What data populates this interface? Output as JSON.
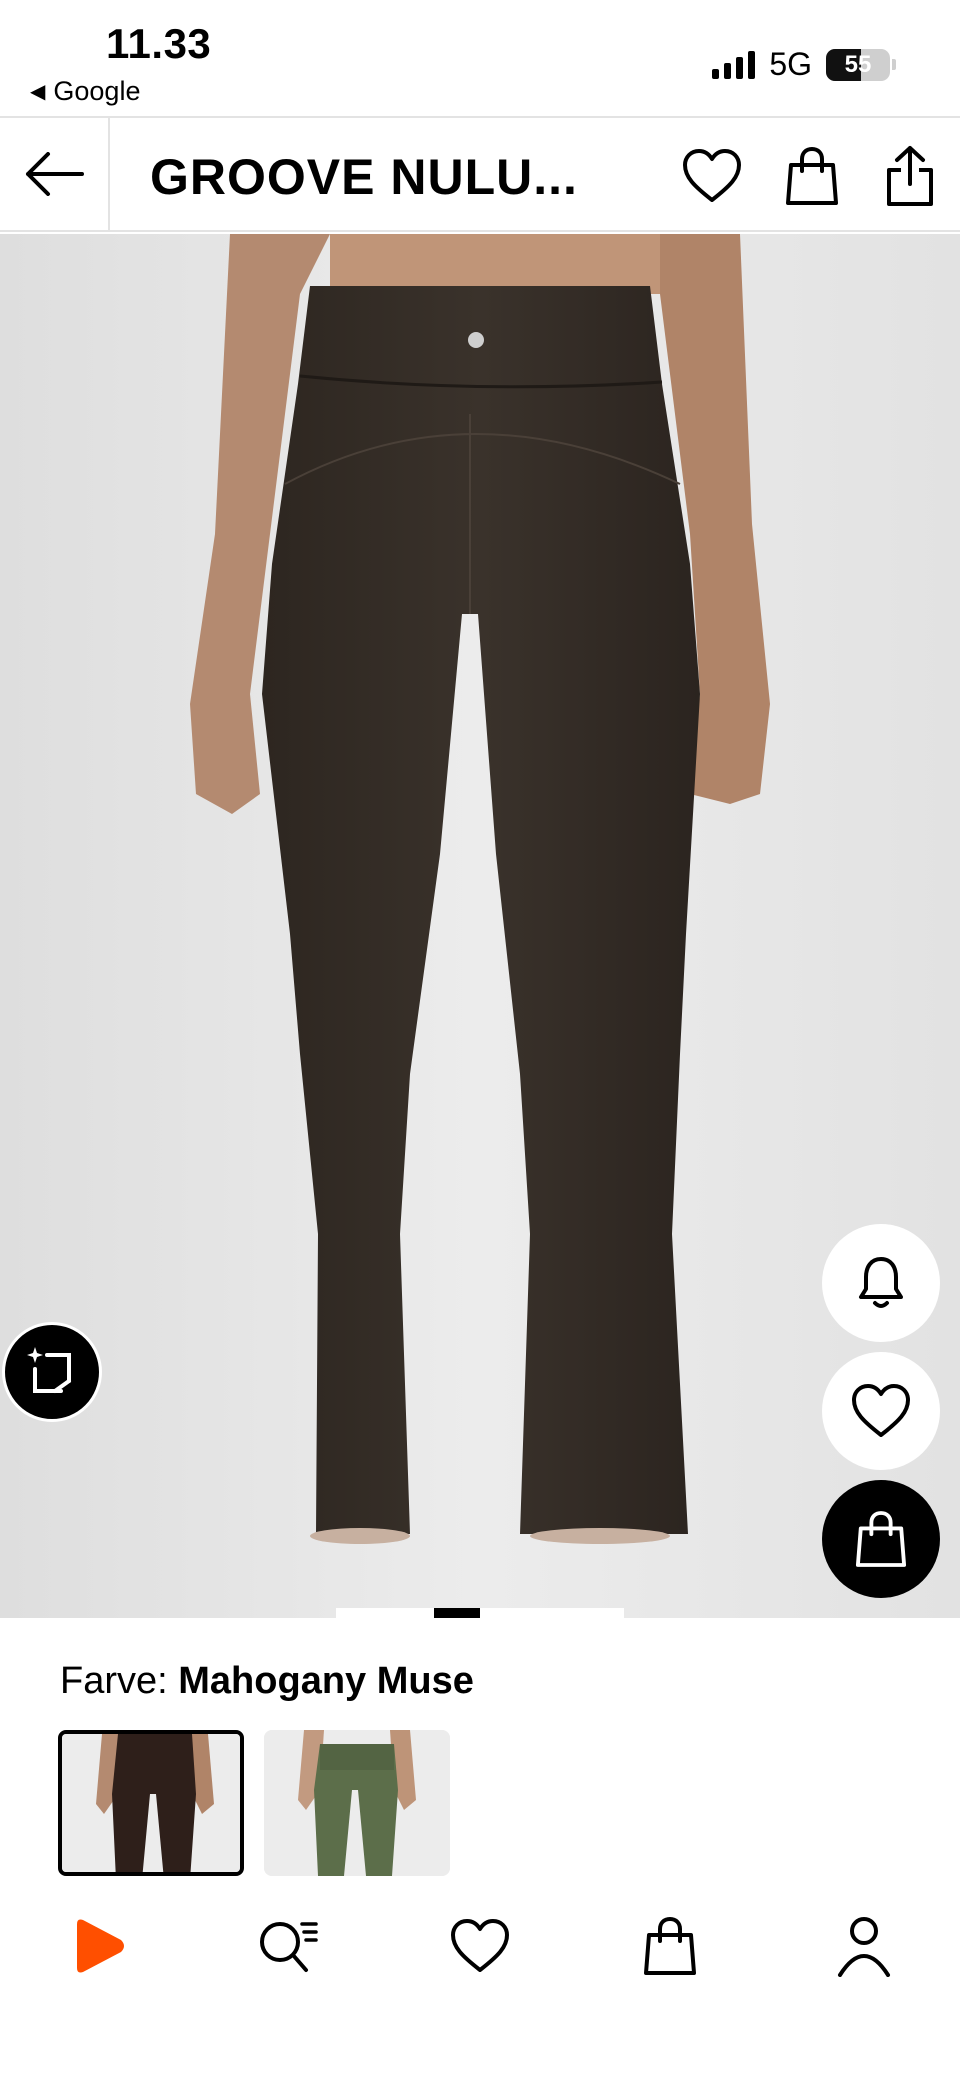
{
  "status_bar": {
    "time": "11.33",
    "back_app": "Google",
    "network": "5G",
    "battery": "55",
    "battery_level": 0.55
  },
  "header": {
    "title": "GROOVE NULU..."
  },
  "product": {
    "gallery_slide_index": 2
  },
  "color": {
    "label": "Farve:",
    "value": "Mahogany Muse",
    "swatches": [
      {
        "color": "#2e1f1a",
        "selected": true
      },
      {
        "color": "#5c6e4a",
        "selected": false
      }
    ]
  },
  "icons": {
    "back": "arrow-left-icon",
    "wishlist": "heart-icon",
    "bag": "shopping-bag-icon",
    "share": "share-icon",
    "notify": "bell-icon",
    "ai_search": "sparkle-crop-icon",
    "nav_home": "play-logo-icon",
    "nav_search": "search-list-icon",
    "nav_wishlist": "heart-icon",
    "nav_bag": "shopping-bag-icon",
    "nav_profile": "user-icon"
  },
  "colors": {
    "accent": "#ff4f00",
    "text": "#000000",
    "background": "#ffffff",
    "image_background": "#e6e6e6",
    "product": "#362e27"
  }
}
